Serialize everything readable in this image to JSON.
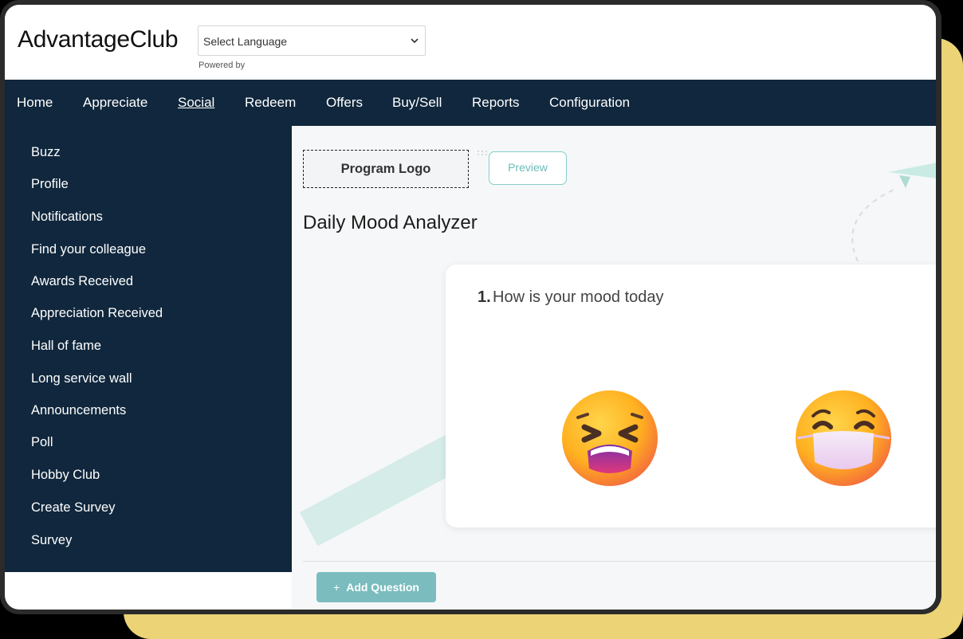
{
  "header": {
    "logo_text": "AdvantageClub",
    "language_select": {
      "value": "Select Language"
    },
    "powered_by": "Powered by"
  },
  "nav": {
    "items": [
      "Home",
      "Appreciate",
      "Social",
      "Redeem",
      "Offers",
      "Buy/Sell",
      "Reports",
      "Configuration"
    ],
    "active": "Social"
  },
  "sidebar": {
    "items": [
      "Buzz",
      "Profile",
      "Notifications",
      "Find your colleague",
      "Awards Received",
      "Appreciation Received",
      "Hall of fame",
      "Long service wall",
      "Announcements",
      "Poll",
      "Hobby Club",
      "Create Survey",
      "Survey"
    ]
  },
  "main": {
    "program_logo": "Program Logo",
    "preview": "Preview",
    "title": "Daily Mood Analyzer",
    "question": {
      "number": "1.",
      "text": "How is your mood today",
      "options": [
        "tired-face-emoji",
        "face-with-medical-mask-emoji"
      ]
    },
    "add_question": "Add Question",
    "add_question_icon": "+"
  },
  "colors": {
    "nav_bg": "#10273d",
    "accent_teal": "#7bbcbe",
    "frame_yellow": "#ecd376"
  }
}
